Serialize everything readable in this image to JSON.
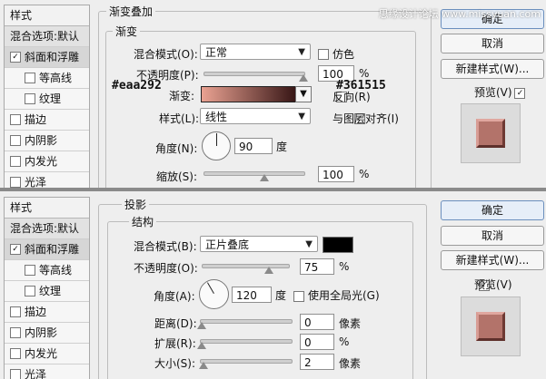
{
  "watermark": "思缘设计论坛 www.missyuan.com",
  "top": {
    "style_list": {
      "header": "样式",
      "blend": "混合选项:默认",
      "items": [
        {
          "label": "斜面和浮雕",
          "checked": "✓"
        },
        {
          "label": "等高线",
          "checked": ""
        },
        {
          "label": "纹理",
          "checked": ""
        },
        {
          "label": "描边",
          "checked": ""
        },
        {
          "label": "内阴影",
          "checked": ""
        },
        {
          "label": "内发光",
          "checked": ""
        },
        {
          "label": "光泽",
          "checked": ""
        }
      ]
    },
    "section_title": "渐变叠加",
    "group_title": "渐变",
    "blend_mode_label": "混合模式(O):",
    "blend_mode_value": "正常",
    "dither_label": "仿色",
    "opacity_label": "不透明度(P):",
    "opacity_value": "100",
    "opacity_unit": "%",
    "gradient_label": "渐变:",
    "reverse_label": "反向(R)",
    "style_label": "样式(L):",
    "style_value": "线性",
    "align_label": "与图层对齐(I)",
    "angle_label": "角度(N):",
    "angle_value": "90",
    "angle_unit": "度",
    "scale_label": "缩放(S):",
    "scale_value": "100",
    "scale_unit": "%",
    "color_start": "#eaa292",
    "color_end": "#361515",
    "buttons": {
      "ok": "确定",
      "cancel": "取消",
      "new_style": "新建样式(W)..."
    },
    "preview_label": "预览(V)"
  },
  "bottom": {
    "style_list": {
      "header": "样式",
      "blend": "混合选项:默认",
      "items": [
        {
          "label": "斜面和浮雕",
          "checked": "✓"
        },
        {
          "label": "等高线",
          "checked": ""
        },
        {
          "label": "纹理",
          "checked": ""
        },
        {
          "label": "描边",
          "checked": ""
        },
        {
          "label": "内阴影",
          "checked": ""
        },
        {
          "label": "内发光",
          "checked": ""
        },
        {
          "label": "光泽",
          "checked": ""
        }
      ]
    },
    "section_title": "投影",
    "group_title": "结构",
    "blend_mode_label": "混合模式(B):",
    "blend_mode_value": "正片叠底",
    "opacity_label": "不透明度(O):",
    "opacity_value": "75",
    "opacity_unit": "%",
    "angle_label": "角度(A):",
    "angle_value": "120",
    "angle_unit": "度",
    "global_light_label": "使用全局光(G)",
    "distance_label": "距离(D):",
    "distance_value": "0",
    "distance_unit": "像素",
    "spread_label": "扩展(R):",
    "spread_value": "0",
    "spread_unit": "%",
    "size_label": "大小(S):",
    "size_value": "2",
    "size_unit": "像素",
    "shadow_color": "#000000",
    "buttons": {
      "ok": "确定",
      "cancel": "取消",
      "new_style": "新建样式(W)..."
    },
    "preview_label": "预览(V)"
  }
}
